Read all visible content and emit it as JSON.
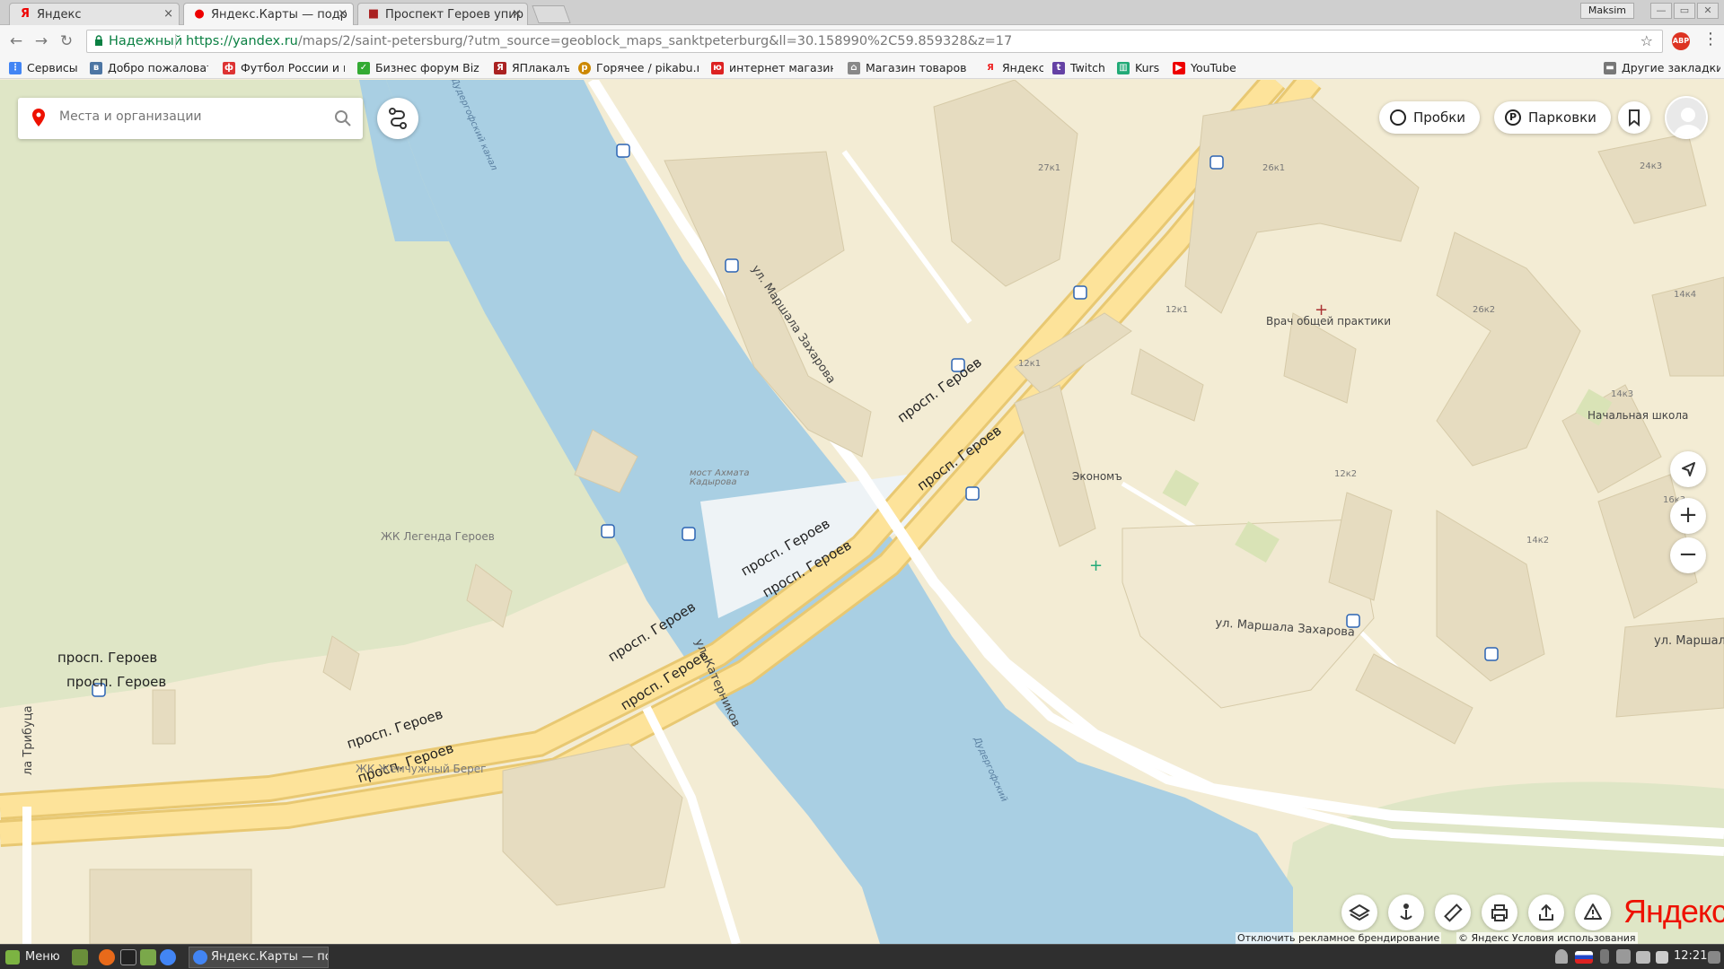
{
  "browser": {
    "tabs": [
      {
        "title": "Яндекс",
        "icon": "yandex-favicon",
        "active": false
      },
      {
        "title": "Яндекс.Карты — подр",
        "icon": "maps-pin-favicon",
        "active": true
      },
      {
        "title": "Проспект Героев упир",
        "icon": "yaplakal-favicon",
        "active": false
      }
    ],
    "tab_close_glyph": "×",
    "profile_name": "Maksim",
    "window_buttons": [
      "—",
      "▭",
      "✕"
    ],
    "security_label": "Надежный",
    "url_host": "https://yandex.ru",
    "url_path": "/maps/2/saint-petersburg/?utm_source=geoblock_maps_sanktpeterburg&ll=30.158990%2C59.859328&z=17",
    "extension_badge": "ABP",
    "bookmarks": [
      {
        "label": "Сервисы",
        "icon": "apps-grid-icon",
        "color": "#4285f4"
      },
      {
        "label": "Добро пожаловать",
        "icon": "vk-icon",
        "color": "#4c75a3"
      },
      {
        "label": "Футбол России и м",
        "icon": "football-icon",
        "color": "#d33"
      },
      {
        "label": "Бизнес форум BizN",
        "icon": "check-icon",
        "color": "#3a3"
      },
      {
        "label": "ЯПлакалъ",
        "icon": "yaplakal-icon",
        "color": "#a22"
      },
      {
        "label": "Горячее / pikabu.ru",
        "icon": "pikabu-icon",
        "color": "#c80"
      },
      {
        "label": "интернет магазин",
        "icon": "shop-icon",
        "color": "#d22"
      },
      {
        "label": "Магазин товаров д",
        "icon": "cart-icon",
        "color": "#888"
      },
      {
        "label": "Яндекс",
        "icon": "yandex-icon",
        "color": "#e22"
      },
      {
        "label": "Twitch",
        "icon": "twitch-icon",
        "color": "#6441a4"
      },
      {
        "label": "Kurs",
        "icon": "chart-icon",
        "color": "#2a7"
      },
      {
        "label": "YouTube",
        "icon": "youtube-icon",
        "color": "#e00"
      }
    ],
    "other_bookmarks": "Другие закладки"
  },
  "map_ui": {
    "search_placeholder": "Места и организации",
    "traffic_label": "Пробки",
    "parking_label": "Парковки",
    "parking_glyph": "P",
    "zoom_in": "+",
    "zoom_out": "−",
    "logo": "Яндекс",
    "ad_disable": "Отключить рекламное брендирование",
    "copyright": "© Яндекс Условия использования"
  },
  "map_labels": {
    "road_geroev_1": "просп. Героев",
    "road_geroev_2": "просп. Героев",
    "road_geroev_3": "просп. Героев",
    "road_geroev_4": "просп. Героев",
    "road_geroev_5": "просп. Героев",
    "road_geroev_6": "просп. Героев",
    "road_geroev_7": "просп. Героев",
    "road_geroev_8": "просп. Героев",
    "road_geroev_9": "просп. Героев",
    "road_geroev_10": "просп. Героев",
    "road_zakharova_1": "ул. Маршала Захарова",
    "road_zakharova_2": "ул. Маршала Захарова",
    "road_zakharova_3": "ул. Маршала",
    "road_katernikov": "ул. Катерников",
    "road_tributsa": "ла Трибуца",
    "bridge": "мост Ахмата Кадырова",
    "canal_1": "Дудергофский канал",
    "canal_2": "Дудергофский",
    "zhk_legenda": "ЖК Легенда Героев",
    "zhk_zhemchuzhny": "ЖК Жемчужный Берег",
    "poi_doctor": "Врач общей практики",
    "poi_econom": "Экономъ",
    "poi_school": "Начальная школа",
    "b_27k1": "27к1",
    "b_26k1": "26к1",
    "b_24k3": "24к3",
    "b_14k4": "14к4",
    "b_12k1a": "12к1",
    "b_12k1b": "12к1",
    "b_26k2": "26к2",
    "b_14k3": "14к3",
    "b_12k2": "12к2",
    "b_16k3": "16к3",
    "b_14k2": "14к2"
  },
  "taskbar": {
    "menu_label": "Меню",
    "window_title": "Яндекс.Карты — по...",
    "clock": "12:21"
  },
  "colors": {
    "water": "#a9cfe3",
    "land": "#f3ecd4",
    "park": "#dfe6c6",
    "road_fill": "#fde39a",
    "road_border": "#e8c872",
    "building": "#e6dcc0",
    "yandex_red": "#e10000"
  }
}
